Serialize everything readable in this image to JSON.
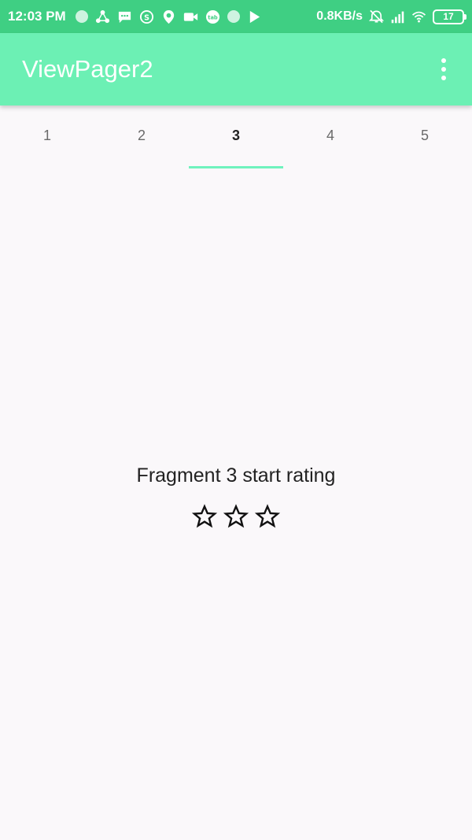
{
  "status_bar": {
    "time": "12:03 PM",
    "net_speed": "0.8KB/s",
    "battery": "17",
    "icons": [
      "dot-icon",
      "share-icon",
      "message-icon",
      "s-icon",
      "location-icon",
      "video-icon",
      "badge-icon",
      "dot-icon",
      "play-store-icon"
    ],
    "right_icons": [
      "alarm-off-icon",
      "signal-icon",
      "wifi-icon",
      "battery-icon"
    ]
  },
  "app_bar": {
    "title": "ViewPager2",
    "menu_icon": "overflow-menu-icon"
  },
  "tabs": [
    {
      "label": "1",
      "selected": false
    },
    {
      "label": "2",
      "selected": false
    },
    {
      "label": "3",
      "selected": true
    },
    {
      "label": "4",
      "selected": false
    },
    {
      "label": "5",
      "selected": false
    }
  ],
  "fragment": {
    "text": "Fragment 3 start rating",
    "rating": 3
  },
  "colors": {
    "status_bar": "#3fcf83",
    "app_bar": "#6cf0b4",
    "indicator": "#6ff2bd",
    "background": "#faf8fa"
  }
}
